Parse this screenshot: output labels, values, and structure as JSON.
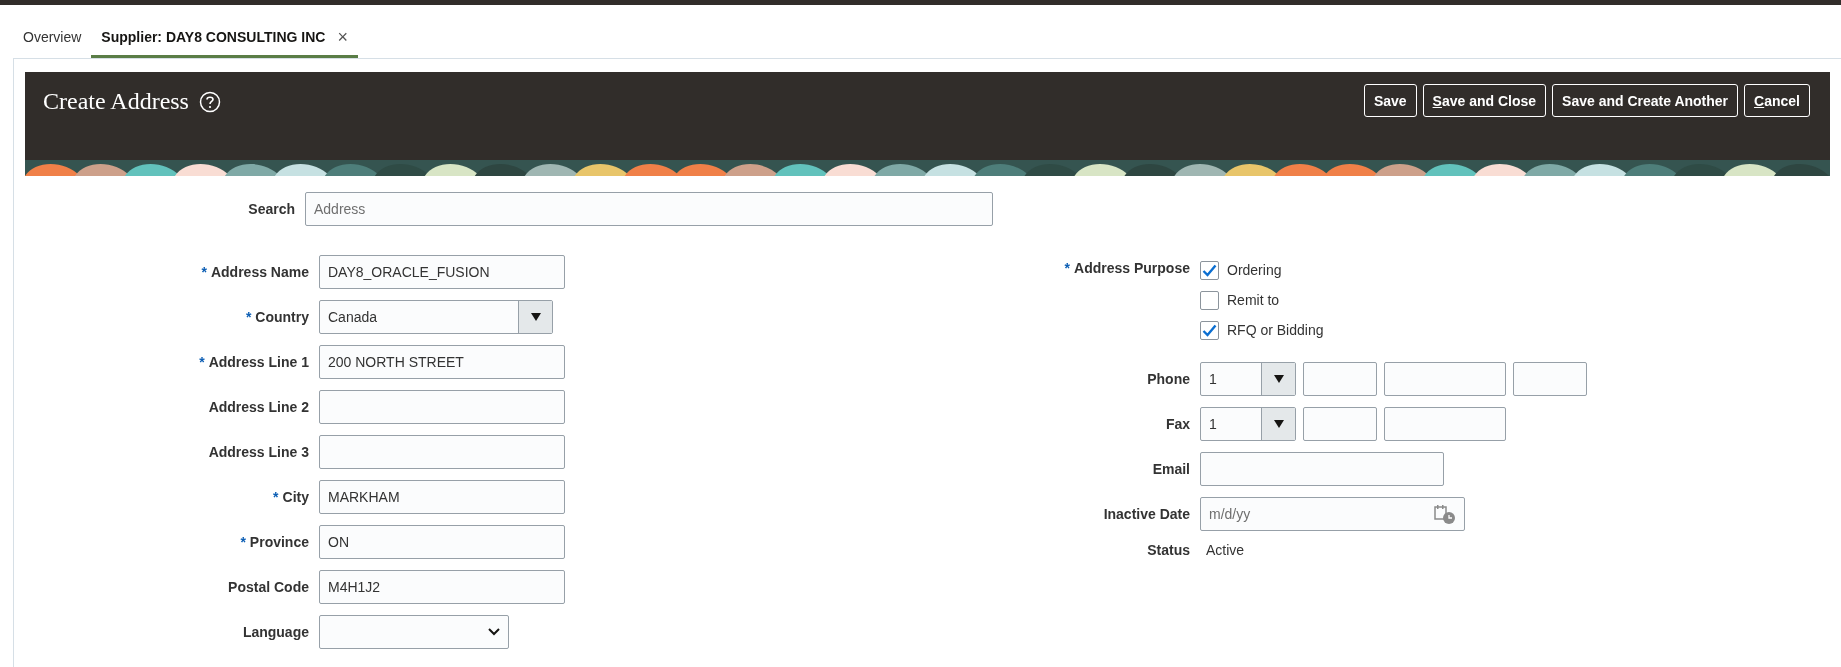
{
  "tabs": [
    {
      "label": "Overview",
      "selected": false,
      "closable": false
    },
    {
      "label": "Supplier: DAY8 CONSULTING INC",
      "selected": true,
      "closable": true
    }
  ],
  "close_glyph": "×",
  "required_mark": "*",
  "header": {
    "title": "Create Address",
    "buttons": [
      {
        "label": "Save",
        "underline_first": false
      },
      {
        "label": "Save and Close",
        "underline_first": true
      },
      {
        "label": "Save and Create Another",
        "underline_first": false
      },
      {
        "label": "Cancel",
        "underline_first": true
      }
    ]
  },
  "search": {
    "label": "Search",
    "placeholder": "Address"
  },
  "left_fields": [
    {
      "label": "Address Name",
      "required": true,
      "kind": "text",
      "value": "DAY8_ORACLE_FUSION"
    },
    {
      "label": "Country",
      "required": true,
      "kind": "combo",
      "value": "Canada"
    },
    {
      "label": "Address Line 1",
      "required": true,
      "kind": "text",
      "value": "200 NORTH STREET"
    },
    {
      "label": "Address Line 2",
      "required": false,
      "kind": "text"
    },
    {
      "label": "Address Line 3",
      "required": false,
      "kind": "text"
    },
    {
      "label": "City",
      "required": true,
      "kind": "text",
      "value": "MARKHAM"
    },
    {
      "label": "Province",
      "required": true,
      "kind": "text",
      "value": "ON"
    },
    {
      "label": "Postal Code",
      "required": false,
      "kind": "text",
      "value": "M4H1J2"
    },
    {
      "label": "Language",
      "required": false,
      "kind": "select"
    }
  ],
  "address_purpose": {
    "label": "Address Purpose",
    "required": true,
    "options": [
      {
        "label": "Ordering",
        "checked": true
      },
      {
        "label": "Remit to",
        "checked": false
      },
      {
        "label": "RFQ or Bidding",
        "checked": true
      }
    ]
  },
  "right_fields": [
    {
      "label": "Phone",
      "kind": "parts",
      "parts": [
        {
          "kind": "combo",
          "value": "1"
        },
        {
          "kind": "short"
        },
        {
          "kind": "long"
        },
        {
          "kind": "short"
        }
      ]
    },
    {
      "label": "Fax",
      "kind": "parts",
      "parts": [
        {
          "kind": "combo",
          "value": "1"
        },
        {
          "kind": "short"
        },
        {
          "kind": "long"
        }
      ]
    },
    {
      "label": "Email",
      "kind": "text"
    },
    {
      "label": "Inactive Date",
      "kind": "date",
      "placeholder": "m/d/yy"
    },
    {
      "label": "Status",
      "kind": "static",
      "value": "Active"
    }
  ]
}
